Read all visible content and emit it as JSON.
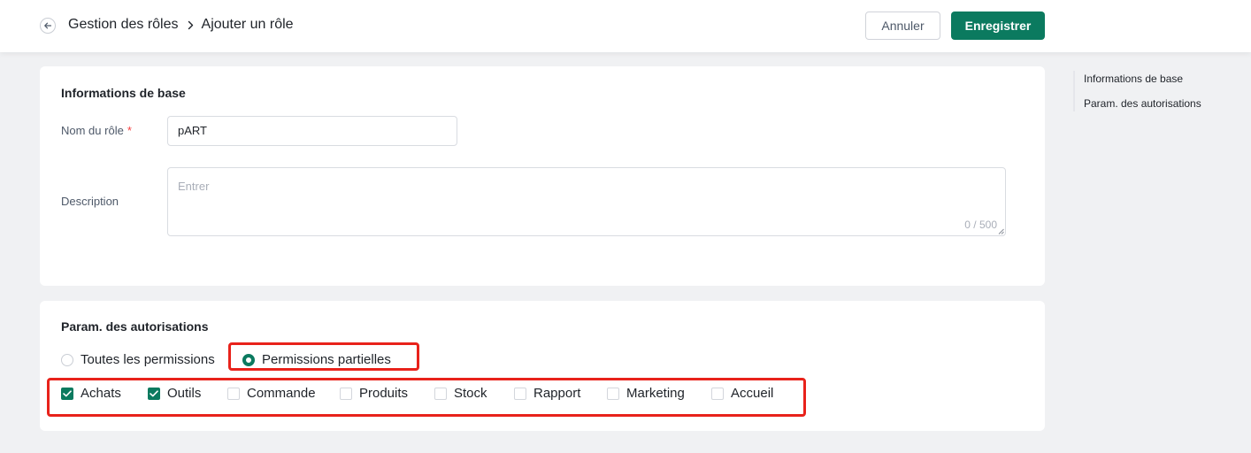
{
  "header": {
    "breadcrumb_parent": "Gestion des rôles",
    "breadcrumb_current": "Ajouter un rôle",
    "cancel_label": "Annuler",
    "save_label": "Enregistrer"
  },
  "basic_info": {
    "title": "Informations de base",
    "role_name_label": "Nom du rôle",
    "required_mark": "*",
    "role_name_value": "pART",
    "description_label": "Description",
    "description_placeholder": "Entrer",
    "description_counter": "0 / 500"
  },
  "permissions": {
    "title": "Param. des autorisations",
    "radio_all": "Toutes les permissions",
    "radio_partial": "Permissions partielles",
    "selected_mode": "partial",
    "modules": [
      {
        "label": "Achats",
        "checked": true
      },
      {
        "label": "Outils",
        "checked": true
      },
      {
        "label": "Commande",
        "checked": false
      },
      {
        "label": "Produits",
        "checked": false
      },
      {
        "label": "Stock",
        "checked": false
      },
      {
        "label": "Rapport",
        "checked": false
      },
      {
        "label": "Marketing",
        "checked": false
      },
      {
        "label": "Accueil",
        "checked": false
      }
    ]
  },
  "anchor_nav": {
    "items": [
      "Informations de base",
      "Param. des autorisations"
    ]
  },
  "colors": {
    "primary": "#0b7a5f",
    "highlight": "#e8221b",
    "required": "#f53f3f"
  }
}
